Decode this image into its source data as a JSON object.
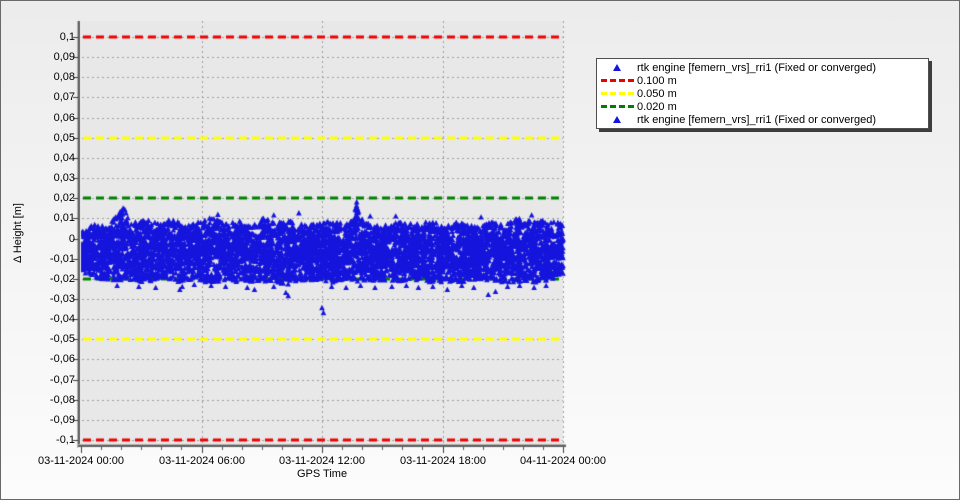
{
  "window": {
    "background_top": "#ececec",
    "background_bottom": "#fcfcfc",
    "border_color": "#696969",
    "plot_background": "#e8e8e8",
    "grid_color": "#9f9f9f"
  },
  "legend": {
    "items": [
      {
        "marker": "triangle",
        "color": "#1414dd",
        "label": "rtk engine [femern_vrs]_rri1 (Fixed or converged)"
      },
      {
        "marker": "dash",
        "color": "#ee0000",
        "label": "0.100 m"
      },
      {
        "marker": "dash",
        "color": "#ffff00",
        "label": "0.050 m"
      },
      {
        "marker": "dash",
        "color": "#008000",
        "label": "0.020 m"
      },
      {
        "marker": "triangle",
        "color": "#1414dd",
        "label": "rtk engine [femern_vrs]_rri1 (Fixed or converged)"
      }
    ]
  },
  "chart_data": {
    "type": "scatter",
    "title": "",
    "xlabel": "GPS Time",
    "ylabel": "Δ Height [m]",
    "xlim_hours": [
      0,
      24
    ],
    "ylim": [
      -0.1,
      0.1
    ],
    "grid": "dashed",
    "legend_position": "outside-top-right",
    "x_ticks": [
      {
        "hours": 0,
        "label": "03-11-2024 00:00"
      },
      {
        "hours": 6,
        "label": "03-11-2024 06:00"
      },
      {
        "hours": 12,
        "label": "03-11-2024 12:00"
      },
      {
        "hours": 18,
        "label": "03-11-2024 18:00"
      },
      {
        "hours": 24,
        "label": "04-11-2024 00:00"
      }
    ],
    "minor_x_tick_every_hours": 1,
    "y_ticks": [
      {
        "value": 0.1,
        "label": "0,1"
      },
      {
        "value": 0.09,
        "label": "0,09"
      },
      {
        "value": 0.08,
        "label": "0,08"
      },
      {
        "value": 0.07,
        "label": "0,07"
      },
      {
        "value": 0.06,
        "label": "0,06"
      },
      {
        "value": 0.05,
        "label": "0,05"
      },
      {
        "value": 0.04,
        "label": "0,04"
      },
      {
        "value": 0.03,
        "label": "0,03"
      },
      {
        "value": 0.02,
        "label": "0,02"
      },
      {
        "value": 0.01,
        "label": "0,01"
      },
      {
        "value": 0,
        "label": "0"
      },
      {
        "value": -0.01,
        "label": "-0,01"
      },
      {
        "value": -0.02,
        "label": "-0,02"
      },
      {
        "value": -0.03,
        "label": "-0,03"
      },
      {
        "value": -0.04,
        "label": "-0,04"
      },
      {
        "value": -0.05,
        "label": "-0,05"
      },
      {
        "value": -0.06,
        "label": "-0,06"
      },
      {
        "value": -0.07,
        "label": "-0,07"
      },
      {
        "value": -0.08,
        "label": "-0,08"
      },
      {
        "value": -0.09,
        "label": "-0,09"
      },
      {
        "value": -0.1,
        "label": "-0,1"
      }
    ],
    "reference_lines": [
      {
        "value": 0.1,
        "color": "#ee0000",
        "label": "0.100 m",
        "style": "dashed"
      },
      {
        "value": 0.05,
        "color": "#ffff00",
        "label": "0.050 m",
        "style": "dashed"
      },
      {
        "value": 0.02,
        "color": "#008000",
        "label": "0.020 m",
        "style": "dashed"
      },
      {
        "value": -0.02,
        "color": "#008000",
        "label": "0.020 m",
        "style": "dashed"
      },
      {
        "value": -0.05,
        "color": "#ffff00",
        "label": "0.050 m",
        "style": "dashed"
      },
      {
        "value": -0.1,
        "color": "#ee0000",
        "label": "0.100 m",
        "style": "dashed"
      }
    ],
    "series": [
      {
        "name": "rtk engine [femern_vrs]_rri1 (Fixed or converged)",
        "marker": "triangle",
        "color": "#1414dd",
        "summary": "Dense band of RTK height residuals between roughly +0.010 m and -0.022 m, centred near -0.006 m, continuous over the full day 03-11-2024 00:00 to 04-11-2024 00:00",
        "sample_count": 6000,
        "seed": 42,
        "band_top_m": [
          [
            0,
            0.004
          ],
          [
            0.02,
            0.007
          ],
          [
            0.055,
            0.006
          ],
          [
            0.075,
            0.013
          ],
          [
            0.09,
            0.0155
          ],
          [
            0.105,
            0.008
          ],
          [
            0.14,
            0.009
          ],
          [
            0.165,
            0.007
          ],
          [
            0.19,
            0.0105
          ],
          [
            0.21,
            0.006
          ],
          [
            0.24,
            0.008
          ],
          [
            0.27,
            0.0105
          ],
          [
            0.3,
            0.007
          ],
          [
            0.33,
            0.009
          ],
          [
            0.35,
            0.006
          ],
          [
            0.38,
            0.0105
          ],
          [
            0.4,
            0.008
          ],
          [
            0.44,
            0.009
          ],
          [
            0.47,
            0.006
          ],
          [
            0.5,
            0.009
          ],
          [
            0.53,
            0.008
          ],
          [
            0.556,
            0.007
          ],
          [
            0.572,
            0.0165
          ],
          [
            0.588,
            0.008
          ],
          [
            0.62,
            0.006
          ],
          [
            0.65,
            0.008
          ],
          [
            0.68,
            0.0075
          ],
          [
            0.72,
            0.009
          ],
          [
            0.75,
            0.0065
          ],
          [
            0.78,
            0.008
          ],
          [
            0.82,
            0.006
          ],
          [
            0.85,
            0.0085
          ],
          [
            0.88,
            0.007
          ],
          [
            0.91,
            0.0105
          ],
          [
            0.94,
            0.008
          ],
          [
            0.97,
            0.0095
          ],
          [
            1,
            0.007
          ]
        ],
        "band_bottom_m": [
          [
            0,
            -0.016
          ],
          [
            0.02,
            -0.019
          ],
          [
            0.05,
            -0.021
          ],
          [
            0.1,
            -0.0205
          ],
          [
            0.13,
            -0.022
          ],
          [
            0.16,
            -0.0205
          ],
          [
            0.19,
            -0.022
          ],
          [
            0.22,
            -0.021
          ],
          [
            0.25,
            -0.022
          ],
          [
            0.28,
            -0.0215
          ],
          [
            0.31,
            -0.022
          ],
          [
            0.34,
            -0.021
          ],
          [
            0.37,
            -0.022
          ],
          [
            0.4,
            -0.0215
          ],
          [
            0.425,
            -0.0235
          ],
          [
            0.44,
            -0.021
          ],
          [
            0.47,
            -0.022
          ],
          [
            0.5,
            -0.0215
          ],
          [
            0.53,
            -0.022
          ],
          [
            0.56,
            -0.021
          ],
          [
            0.6,
            -0.022
          ],
          [
            0.63,
            -0.0215
          ],
          [
            0.66,
            -0.022
          ],
          [
            0.7,
            -0.021
          ],
          [
            0.73,
            -0.022
          ],
          [
            0.76,
            -0.0215
          ],
          [
            0.79,
            -0.022
          ],
          [
            0.82,
            -0.021
          ],
          [
            0.85,
            -0.0205
          ],
          [
            0.88,
            -0.022
          ],
          [
            0.91,
            -0.0215
          ],
          [
            0.94,
            -0.022
          ],
          [
            0.97,
            -0.021
          ],
          [
            1,
            -0.018
          ]
        ],
        "outliers_m": [
          [
            0.075,
            -0.0235
          ],
          [
            0.12,
            -0.024
          ],
          [
            0.155,
            -0.0245
          ],
          [
            0.205,
            -0.0255
          ],
          [
            0.21,
            -0.024
          ],
          [
            0.235,
            -0.023
          ],
          [
            0.27,
            -0.0235
          ],
          [
            0.3,
            -0.024
          ],
          [
            0.345,
            -0.0245
          ],
          [
            0.36,
            -0.0255
          ],
          [
            0.4,
            -0.024
          ],
          [
            0.425,
            -0.027
          ],
          [
            0.43,
            -0.0285
          ],
          [
            0.5,
            -0.0345
          ],
          [
            0.503,
            -0.037
          ],
          [
            0.52,
            -0.024
          ],
          [
            0.55,
            -0.0245
          ],
          [
            0.58,
            -0.0235
          ],
          [
            0.61,
            -0.0245
          ],
          [
            0.645,
            -0.024
          ],
          [
            0.675,
            -0.0235
          ],
          [
            0.7,
            -0.0245
          ],
          [
            0.73,
            -0.024
          ],
          [
            0.76,
            -0.0255
          ],
          [
            0.79,
            -0.0235
          ],
          [
            0.815,
            -0.0245
          ],
          [
            0.845,
            -0.028
          ],
          [
            0.86,
            -0.0265
          ],
          [
            0.885,
            -0.024
          ],
          [
            0.91,
            -0.0235
          ],
          [
            0.94,
            -0.0245
          ],
          [
            0.965,
            -0.0235
          ],
          [
            0.088,
            0.0145
          ],
          [
            0.284,
            0.0118
          ],
          [
            0.4,
            0.0115
          ],
          [
            0.452,
            0.0125
          ],
          [
            0.572,
            0.018
          ],
          [
            0.6,
            0.011
          ],
          [
            0.653,
            0.011
          ],
          [
            0.83,
            0.0105
          ],
          [
            0.935,
            0.0115
          ]
        ]
      }
    ]
  }
}
